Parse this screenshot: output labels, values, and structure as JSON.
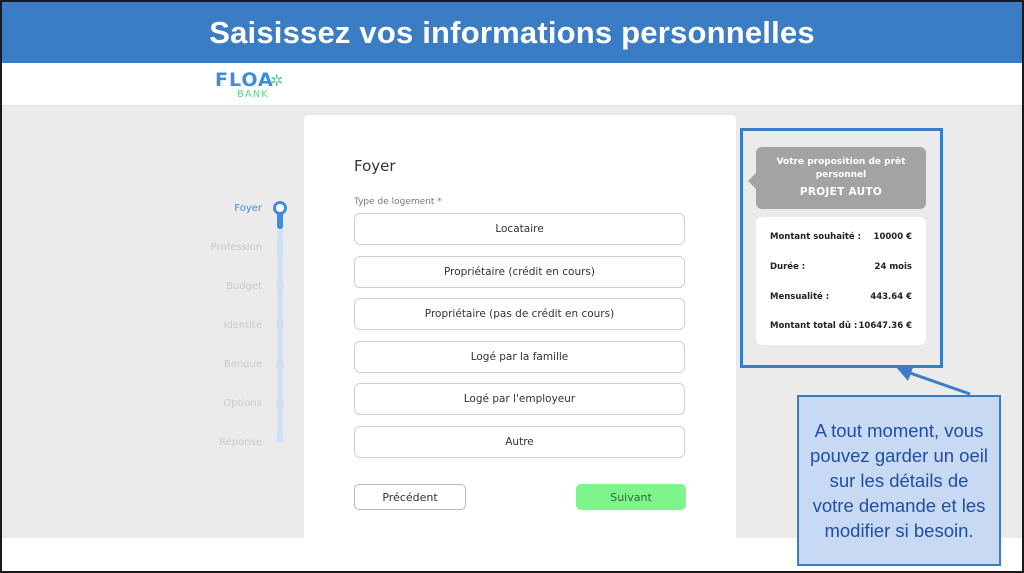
{
  "banner": {
    "title": "Saisissez vos informations personnelles"
  },
  "brand": {
    "name": "FLOA",
    "sub": "BANK"
  },
  "stepper": {
    "steps": [
      "Foyer",
      "Profession",
      "Budget",
      "Identité",
      "Banque",
      "Options",
      "Réponse"
    ],
    "active_index": 0
  },
  "form": {
    "title": "Foyer",
    "field_label": "Type de logement",
    "required_mark": "*",
    "options": [
      "Locataire",
      "Propriétaire (crédit en cours)",
      "Propriétaire (pas de crédit en cours)",
      "Logé par la famille",
      "Logé par l'employeur",
      "Autre"
    ],
    "prev_label": "Précédent",
    "next_label": "Suivant"
  },
  "proposal": {
    "title": "Votre proposition de prêt personnel",
    "subtitle": "PROJET AUTO",
    "rows": [
      {
        "label": "Montant souhaité :",
        "value": "10000 €"
      },
      {
        "label": "Durée :",
        "value": "24 mois"
      },
      {
        "label": "Mensualité :",
        "value": "443.64 €"
      },
      {
        "label": "Montant total dû :",
        "value": "10647.36 €"
      }
    ]
  },
  "callout": {
    "text": "A tout moment, vous pouvez garder un oeil sur les détails de votre demande et les modifier si besoin."
  },
  "colors": {
    "banner": "#3b7dc4",
    "accent": "#3c8dde",
    "next_button": "#7ef58c",
    "callout_bg": "#c7d9f3"
  }
}
